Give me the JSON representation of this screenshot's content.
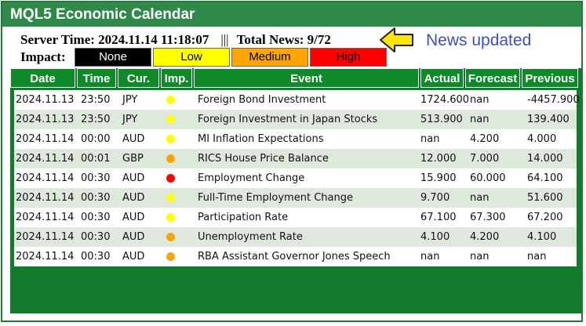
{
  "app": {
    "title": "MQL5 Economic Calendar"
  },
  "status": {
    "server_label": "Server Time: 2024.11.14 11:18:07",
    "separator": "|||",
    "news_label": "Total News: 9/72",
    "updated_note": "News updated"
  },
  "impact": {
    "label": "Impact:",
    "buttons": [
      {
        "label": "None",
        "bg": "#000000",
        "fg": "#ffffff"
      },
      {
        "label": "Low",
        "bg": "#ffff00",
        "fg": "#000000"
      },
      {
        "label": "Medium",
        "bg": "#ffa500",
        "fg": "#000000"
      },
      {
        "label": "High",
        "bg": "#ff0000",
        "fg": "#000000"
      }
    ]
  },
  "table": {
    "headers": [
      "Date",
      "Time",
      "Cur.",
      "Imp.",
      "Event",
      "Actual",
      "Forecast",
      "Previous"
    ],
    "rows": [
      {
        "date": "2024.11.13",
        "time": "23:50",
        "cur": "JPY",
        "imp": "#ffff00",
        "event": "Foreign Bond Investment",
        "actual": "1724.600",
        "forecast": "nan",
        "previous": "-4457.900"
      },
      {
        "date": "2024.11.13",
        "time": "23:50",
        "cur": "JPY",
        "imp": "#ffff00",
        "event": "Foreign Investment in Japan Stocks",
        "actual": "513.900",
        "forecast": "nan",
        "previous": "139.400"
      },
      {
        "date": "2024.11.14",
        "time": "00:00",
        "cur": "AUD",
        "imp": "#ffff00",
        "event": "MI Inflation Expectations",
        "actual": "nan",
        "forecast": "4.200",
        "previous": "4.000"
      },
      {
        "date": "2024.11.14",
        "time": "00:01",
        "cur": "GBP",
        "imp": "#ffa500",
        "event": "RICS House Price Balance",
        "actual": "12.000",
        "forecast": "7.000",
        "previous": "14.000"
      },
      {
        "date": "2024.11.14",
        "time": "00:30",
        "cur": "AUD",
        "imp": "#ff0000",
        "event": "Employment Change",
        "actual": "15.900",
        "forecast": "60.000",
        "previous": "64.100"
      },
      {
        "date": "2024.11.14",
        "time": "00:30",
        "cur": "AUD",
        "imp": "#ffff00",
        "event": "Full-Time Employment Change",
        "actual": "9.700",
        "forecast": "nan",
        "previous": "51.600"
      },
      {
        "date": "2024.11.14",
        "time": "00:30",
        "cur": "AUD",
        "imp": "#ffff00",
        "event": "Participation Rate",
        "actual": "67.100",
        "forecast": "67.300",
        "previous": "67.200"
      },
      {
        "date": "2024.11.14",
        "time": "00:30",
        "cur": "AUD",
        "imp": "#ffa500",
        "event": "Unemployment Rate",
        "actual": "4.100",
        "forecast": "4.200",
        "previous": "4.100"
      },
      {
        "date": "2024.11.14",
        "time": "00:30",
        "cur": "AUD",
        "imp": "#ffa500",
        "event": "RBA Assistant Governor Jones Speech",
        "actual": "nan",
        "forecast": "nan",
        "previous": "nan"
      }
    ]
  },
  "colors": {
    "title_bar": "#2f8a4a",
    "table_body": "#117a2b",
    "header_cell": "#0e8a28",
    "row_alt": "#dfe8dd",
    "note_text": "#3b4fc4",
    "arrow": "#ffe600"
  }
}
